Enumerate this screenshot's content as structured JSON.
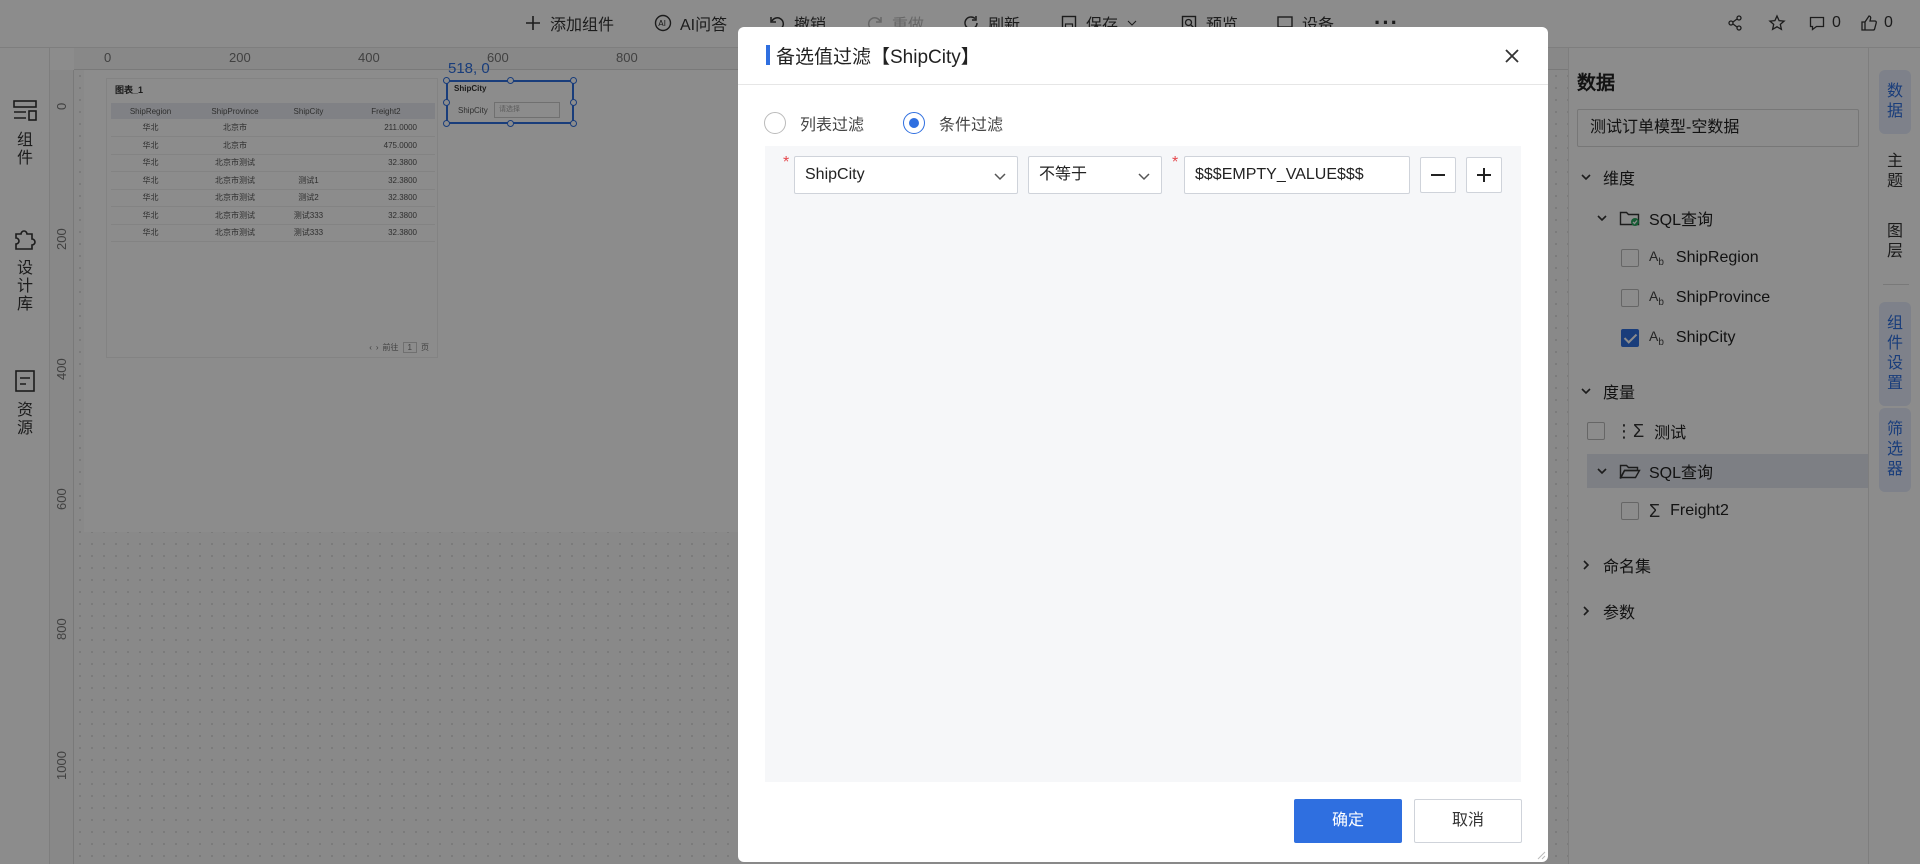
{
  "toolbar": {
    "add_component": "添加组件",
    "ai_ask": "AI问答",
    "undo": "撤销",
    "redo": "重做",
    "refresh": "刷新",
    "save": "保存",
    "preview": "预览",
    "device": "设备",
    "comments_count": "0",
    "likes_count": "0"
  },
  "left_rail": {
    "components": "组件",
    "design_library": "设计库",
    "resources": "资源"
  },
  "canvas": {
    "ruler_h": [
      "0",
      "200",
      "400",
      "600",
      "800"
    ],
    "ruler_v": [
      "0",
      "200",
      "400",
      "600",
      "800",
      "1000"
    ],
    "coord": "518, 0",
    "table_widget": {
      "title": "图表_1",
      "columns": [
        "ShipRegion",
        "ShipProvince",
        "ShipCity",
        "Freight2"
      ],
      "rows": [
        [
          "华北",
          "北京市",
          "",
          "211.0000"
        ],
        [
          "华北",
          "北京市",
          "",
          "475.0000"
        ],
        [
          "华北",
          "北京市测试",
          "",
          "32.3800"
        ],
        [
          "华北",
          "北京市测试",
          "测试1",
          "32.3800"
        ],
        [
          "华北",
          "北京市测试",
          "测试2",
          "32.3800"
        ],
        [
          "华北",
          "北京市测试",
          "测试333",
          "32.3800"
        ],
        [
          "华北",
          "北京市测试",
          "测试333",
          "32.3800"
        ]
      ],
      "pager_prefix": "前往",
      "pager_page": "1",
      "pager_suffix": "页"
    },
    "filter_widget": {
      "title": "ShipCity",
      "label": "ShipCity",
      "placeholder": "请选择"
    }
  },
  "right_panel": {
    "title": "数据",
    "model": "测试订单模型-空数据",
    "dimensions_label": "维度",
    "dim_folder": "SQL查询",
    "dim_fields": [
      {
        "name": "ShipRegion",
        "checked": false
      },
      {
        "name": "ShipProvince",
        "checked": false
      },
      {
        "name": "ShipCity",
        "checked": true
      }
    ],
    "measures_label": "度量",
    "measure_test": "测试",
    "measure_folder": "SQL查询",
    "measure_field": "Freight2",
    "named_sets": "命名集",
    "params": "参数"
  },
  "vtabs": {
    "data": "数据",
    "theme": "主题",
    "layers": "图层",
    "component_settings": "组件设置",
    "filter": "筛选器"
  },
  "modal": {
    "title": "备选值过滤【ShipCity】",
    "radio_list": "列表过滤",
    "radio_condition": "条件过滤",
    "selected_mode": "condition",
    "condition": {
      "field": "ShipCity",
      "operator": "不等于",
      "value": "$$$EMPTY_VALUE$$$"
    },
    "ok": "确定",
    "cancel": "取消"
  },
  "colors": {
    "accent": "#2f6fe0",
    "required": "#e5484d"
  }
}
